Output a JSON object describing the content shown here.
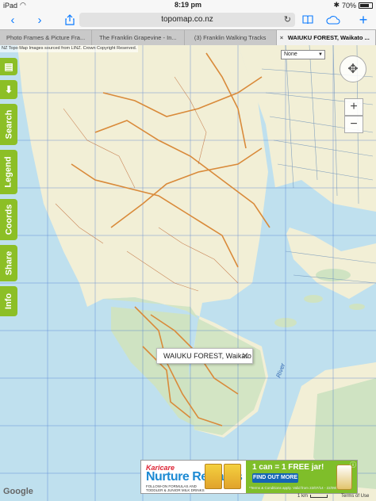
{
  "status": {
    "device": "iPad",
    "time": "8:19 pm",
    "battery": "70%"
  },
  "toolbar": {
    "url": "topomap.co.nz"
  },
  "tabs": [
    {
      "label": "Photo Frames & Picture Fra...",
      "active": false
    },
    {
      "label": "The Franklin Grapevine - In...",
      "active": false
    },
    {
      "label": "(3) Franklin Walking Tracks",
      "active": false
    },
    {
      "label": "WAIUKU FOREST, Waikato ...",
      "active": true
    }
  ],
  "map": {
    "attribution": "NZ Topo Map Images sourced from LINZ. Crown Copyright Reserved.",
    "layer_select": "None",
    "side_tabs": [
      {
        "name": "print",
        "label": ""
      },
      {
        "name": "download",
        "label": ""
      },
      {
        "name": "search",
        "label": "Search"
      },
      {
        "name": "legend",
        "label": "Legend"
      },
      {
        "name": "coords",
        "label": "Coords"
      },
      {
        "name": "share",
        "label": "Share"
      },
      {
        "name": "info",
        "label": "Info"
      }
    ],
    "zoom_in": "+",
    "zoom_out": "−",
    "info_bubble": "WAIUKU FOREST, Waikato",
    "google": "Google",
    "scale": "1 km",
    "terms": "Terms of Use",
    "colors": {
      "water": "#bfe0ee",
      "land": "#f2efd6",
      "forest": "#cfe3c2",
      "road": "#d98a3a",
      "grid": "#3a6fd0",
      "accent": "#8cbf26"
    }
  },
  "ad": {
    "brand_top": "Karicare",
    "brand": "Nurture Rewards",
    "fine_print": "FOLLOW-ON FORMULAS AND TODDLER & JUNIOR MILK DRINKS",
    "offer": "1 can = 1 FREE jar!",
    "cta": "FIND OUT MORE",
    "terms": "*Terms & Conditions apply. Valid from 22/07/14 - 22/09/14"
  }
}
